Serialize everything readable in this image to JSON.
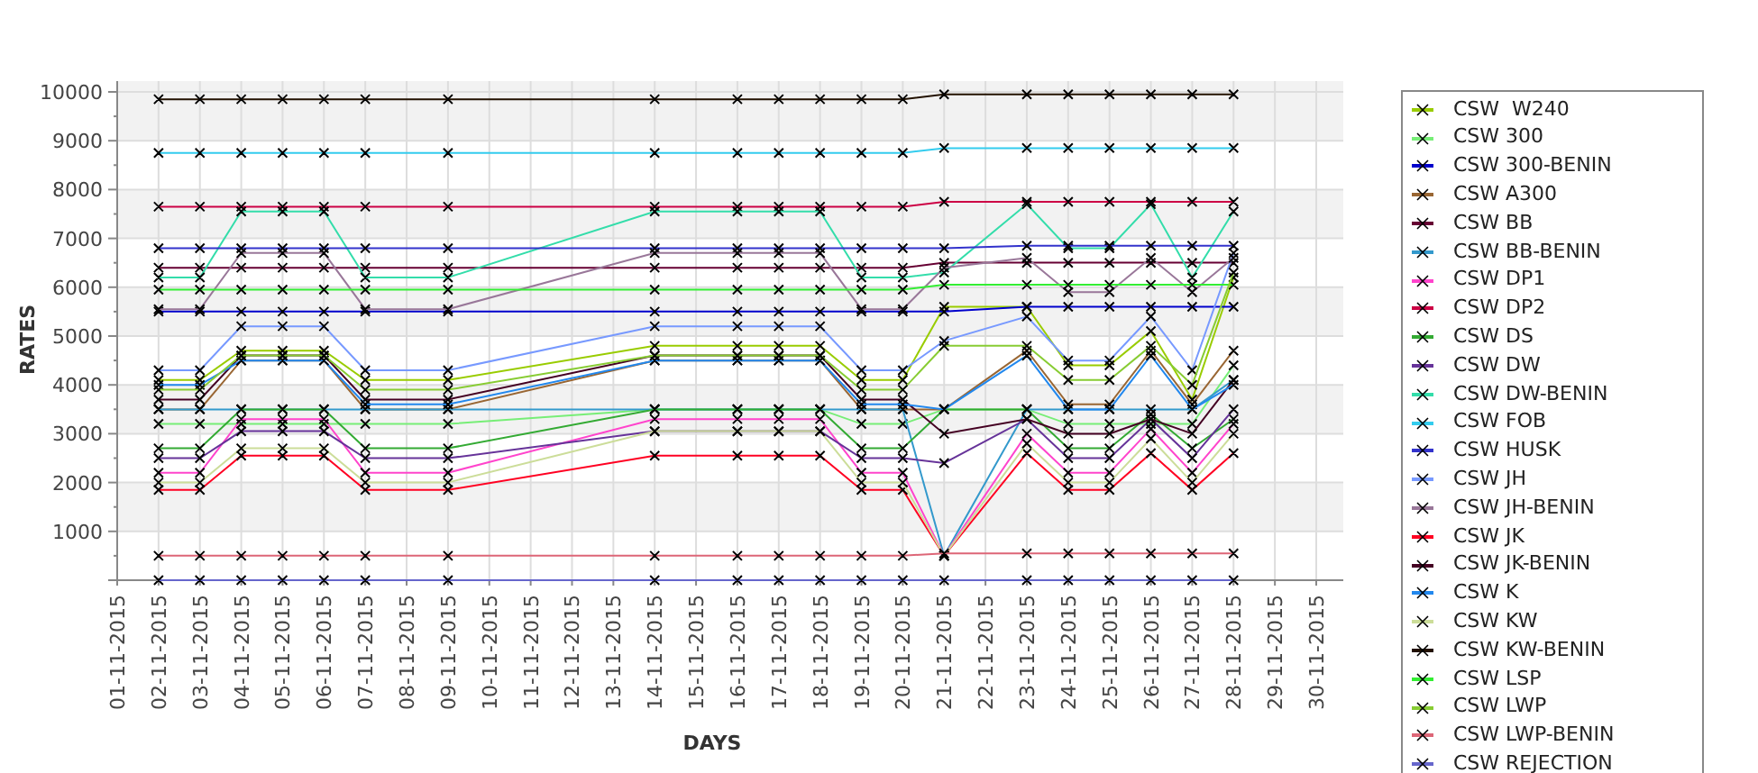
{
  "chart_data": {
    "type": "line",
    "xlabel": "DAYS",
    "ylabel": "RATES",
    "grid": true,
    "categories": [
      "01-11-2015",
      "02-11-2015",
      "03-11-2015",
      "04-11-2015",
      "05-11-2015",
      "06-11-2015",
      "07-11-2015",
      "08-11-2015",
      "09-11-2015",
      "10-11-2015",
      "11-11-2015",
      "12-11-2015",
      "13-11-2015",
      "14-11-2015",
      "15-11-2015",
      "16-11-2015",
      "17-11-2015",
      "18-11-2015",
      "19-11-2015",
      "20-11-2015",
      "21-11-2015",
      "22-11-2015",
      "23-11-2015",
      "24-11-2015",
      "25-11-2015",
      "26-11-2015",
      "27-11-2015",
      "28-11-2015",
      "29-11-2015",
      "30-11-2015"
    ],
    "ylim": [
      0,
      10000
    ],
    "yticks": [
      1000,
      2000,
      3000,
      4000,
      5000,
      6000,
      7000,
      8000,
      9000,
      10000
    ],
    "series": [
      {
        "name": "CSW  W240",
        "color": "#99cc00",
        "marker": "x",
        "values": [
          null,
          4100,
          4100,
          4700,
          4700,
          4700,
          4100,
          null,
          4100,
          null,
          null,
          null,
          null,
          4800,
          null,
          4800,
          4800,
          4800,
          4100,
          4100,
          5600,
          null,
          5600,
          4400,
          4400,
          5100,
          3700,
          6200,
          null,
          null
        ]
      },
      {
        "name": "CSW 300",
        "color": "#77ee77",
        "marker": "x",
        "values": [
          null,
          3200,
          3200,
          3200,
          3200,
          3200,
          3200,
          null,
          3200,
          null,
          null,
          null,
          null,
          3500,
          null,
          3500,
          3500,
          3500,
          3200,
          3200,
          3500,
          null,
          3500,
          3200,
          3200,
          3200,
          3200,
          4400,
          null,
          null
        ]
      },
      {
        "name": "CSW 300-BENIN",
        "color": "#0000cc",
        "marker": "x",
        "values": [
          null,
          5500,
          5500,
          5500,
          5500,
          5500,
          5500,
          null,
          5500,
          null,
          null,
          null,
          null,
          5500,
          null,
          5500,
          5500,
          5500,
          5500,
          5500,
          5500,
          null,
          5600,
          5600,
          5600,
          5600,
          5600,
          5600,
          null,
          null
        ]
      },
      {
        "name": "CSW A300",
        "color": "#996633",
        "marker": "x",
        "values": [
          null,
          3500,
          3500,
          4500,
          4500,
          4500,
          3500,
          null,
          3500,
          null,
          null,
          null,
          null,
          4500,
          null,
          4500,
          4500,
          4500,
          3500,
          3500,
          3500,
          null,
          4700,
          3600,
          3600,
          4700,
          3600,
          4700,
          null,
          null
        ]
      },
      {
        "name": "CSW BB",
        "color": "#660033",
        "marker": "x",
        "values": [
          null,
          6400,
          6400,
          6400,
          6400,
          6400,
          6400,
          null,
          6400,
          null,
          null,
          null,
          null,
          6400,
          null,
          6400,
          6400,
          6400,
          6400,
          6400,
          6500,
          null,
          6500,
          6500,
          6500,
          6500,
          6500,
          6500,
          null,
          null
        ]
      },
      {
        "name": "CSW BB-BENIN",
        "color": "#3399cc",
        "marker": "x",
        "values": [
          null,
          3500,
          3500,
          3500,
          3500,
          3500,
          3500,
          null,
          3500,
          null,
          null,
          null,
          null,
          3500,
          null,
          3500,
          3500,
          3500,
          3500,
          3500,
          500,
          null,
          3500,
          3500,
          3500,
          3500,
          3500,
          4100,
          null,
          null
        ]
      },
      {
        "name": "CSW DP1",
        "color": "#ff44cc",
        "marker": "x",
        "values": [
          null,
          2200,
          2200,
          3300,
          3300,
          3300,
          2200,
          null,
          2200,
          null,
          null,
          null,
          null,
          3300,
          null,
          3300,
          3300,
          3300,
          2200,
          2200,
          500,
          null,
          3000,
          2200,
          2200,
          3100,
          2200,
          3200,
          null,
          null
        ]
      },
      {
        "name": "CSW DP2",
        "color": "#cc0044",
        "marker": "x",
        "values": [
          null,
          7650,
          7650,
          7650,
          7650,
          7650,
          7650,
          null,
          7650,
          null,
          null,
          null,
          null,
          7650,
          null,
          7650,
          7650,
          7650,
          7650,
          7650,
          7750,
          null,
          7750,
          7750,
          7750,
          7750,
          7750,
          7750,
          null,
          null
        ]
      },
      {
        "name": "CSW DS",
        "color": "#33aa33",
        "marker": "x",
        "values": [
          null,
          2700,
          2700,
          3500,
          3500,
          3500,
          2700,
          null,
          2700,
          null,
          null,
          null,
          null,
          3500,
          null,
          3500,
          3500,
          3500,
          2700,
          2700,
          3500,
          null,
          3500,
          2700,
          2700,
          3400,
          2700,
          3300,
          null,
          null
        ]
      },
      {
        "name": "CSW DW",
        "color": "#663399",
        "marker": "x",
        "values": [
          null,
          2500,
          2500,
          3050,
          3050,
          3050,
          2500,
          null,
          2500,
          null,
          null,
          null,
          null,
          3050,
          null,
          3050,
          3050,
          3050,
          2500,
          2500,
          2400,
          null,
          3300,
          2500,
          2500,
          3300,
          2500,
          3500,
          null,
          null
        ]
      },
      {
        "name": "CSW DW-BENIN",
        "color": "#33ddaa",
        "marker": "x",
        "values": [
          null,
          6200,
          6200,
          7550,
          7550,
          7550,
          6200,
          null,
          6200,
          null,
          null,
          null,
          null,
          7550,
          null,
          7550,
          7550,
          7550,
          6200,
          6200,
          6300,
          null,
          7700,
          6800,
          6800,
          7700,
          6200,
          7550,
          null,
          null
        ]
      },
      {
        "name": "CSW FOB",
        "color": "#33ccee",
        "marker": "x",
        "values": [
          null,
          8750,
          8750,
          8750,
          8750,
          8750,
          8750,
          null,
          8750,
          null,
          null,
          null,
          null,
          8750,
          null,
          8750,
          8750,
          8750,
          8750,
          8750,
          8850,
          null,
          8850,
          8850,
          8850,
          8850,
          8850,
          8850,
          null,
          null
        ]
      },
      {
        "name": "CSW HUSK",
        "color": "#3333cc",
        "marker": "x",
        "values": [
          null,
          6800,
          6800,
          6800,
          6800,
          6800,
          6800,
          null,
          6800,
          null,
          null,
          null,
          null,
          6800,
          null,
          6800,
          6800,
          6800,
          6800,
          6800,
          6800,
          null,
          6850,
          6850,
          6850,
          6850,
          6850,
          6850,
          null,
          null
        ]
      },
      {
        "name": "CSW JH",
        "color": "#7799ff",
        "marker": "x",
        "values": [
          null,
          4300,
          4300,
          5200,
          5200,
          5200,
          4300,
          null,
          4300,
          null,
          null,
          null,
          null,
          5200,
          null,
          5200,
          5200,
          5200,
          4300,
          4300,
          4900,
          null,
          5400,
          4500,
          4500,
          5400,
          4300,
          6700,
          null,
          null
        ]
      },
      {
        "name": "CSW JH-BENIN",
        "color": "#997799",
        "marker": "x",
        "values": [
          null,
          5550,
          5550,
          6700,
          6700,
          6700,
          5550,
          null,
          5550,
          null,
          null,
          null,
          null,
          6700,
          null,
          6700,
          6700,
          6700,
          5550,
          5550,
          6400,
          null,
          6600,
          5900,
          5900,
          6600,
          5900,
          6600,
          null,
          null
        ]
      },
      {
        "name": "CSW JK",
        "color": "#ff0022",
        "marker": "x",
        "values": [
          null,
          1850,
          1850,
          2550,
          2550,
          2550,
          1850,
          null,
          1850,
          null,
          null,
          null,
          null,
          2550,
          null,
          2550,
          2550,
          2550,
          1850,
          1850,
          500,
          null,
          2600,
          1850,
          1850,
          2600,
          1850,
          2600,
          null,
          null
        ]
      },
      {
        "name": "CSW JK-BENIN",
        "color": "#440022",
        "marker": "x",
        "values": [
          null,
          3700,
          3700,
          4600,
          4600,
          4600,
          3700,
          null,
          3700,
          null,
          null,
          null,
          null,
          4600,
          null,
          4600,
          4600,
          4600,
          3700,
          3700,
          3000,
          null,
          3300,
          3000,
          3000,
          3300,
          3000,
          4100,
          null,
          null
        ]
      },
      {
        "name": "CSW K",
        "color": "#2288ee",
        "marker": "x",
        "values": [
          null,
          4000,
          4000,
          4500,
          4500,
          4500,
          3600,
          null,
          3600,
          null,
          null,
          null,
          null,
          4500,
          null,
          4500,
          4500,
          4500,
          3600,
          3600,
          3500,
          null,
          4600,
          3500,
          3500,
          4600,
          3500,
          4000,
          null,
          null
        ]
      },
      {
        "name": "CSW KW",
        "color": "#ccdd99",
        "marker": "x",
        "values": [
          null,
          2000,
          2000,
          2700,
          2700,
          2700,
          2000,
          null,
          2000,
          null,
          null,
          null,
          null,
          3050,
          null,
          3050,
          3050,
          3050,
          2000,
          2000,
          500,
          null,
          2800,
          2000,
          2000,
          2900,
          2000,
          3000,
          null,
          null
        ]
      },
      {
        "name": "CSW KW-BENIN",
        "color": "#221100",
        "marker": "x",
        "values": [
          null,
          9850,
          9850,
          9850,
          9850,
          9850,
          9850,
          null,
          9850,
          null,
          null,
          null,
          null,
          9850,
          null,
          9850,
          9850,
          9850,
          9850,
          9850,
          9950,
          null,
          9950,
          9950,
          9950,
          9950,
          9950,
          9950,
          null,
          null
        ]
      },
      {
        "name": "CSW LSP",
        "color": "#33ee33",
        "marker": "x",
        "values": [
          null,
          5950,
          5950,
          5950,
          5950,
          5950,
          5950,
          null,
          5950,
          null,
          null,
          null,
          null,
          5950,
          null,
          5950,
          5950,
          5950,
          5950,
          5950,
          6050,
          null,
          6050,
          6050,
          6050,
          6050,
          6050,
          6050,
          null,
          null
        ]
      },
      {
        "name": "CSW LWP",
        "color": "#88cc33",
        "marker": "x",
        "values": [
          null,
          3900,
          3900,
          4600,
          4600,
          4600,
          3900,
          null,
          3900,
          null,
          null,
          null,
          null,
          4600,
          null,
          4600,
          4600,
          4600,
          3900,
          3900,
          4800,
          null,
          4800,
          4100,
          4100,
          4800,
          4000,
          6300,
          null,
          null
        ]
      },
      {
        "name": "CSW LWP-BENIN",
        "color": "#dd6677",
        "marker": "x",
        "values": [
          null,
          500,
          500,
          500,
          500,
          500,
          500,
          null,
          500,
          null,
          null,
          null,
          null,
          500,
          null,
          500,
          500,
          500,
          500,
          500,
          550,
          null,
          550,
          550,
          550,
          550,
          550,
          550,
          null,
          null
        ]
      },
      {
        "name": "CSW REJECTION",
        "color": "#6666cc",
        "marker": "x",
        "values": [
          null,
          0,
          0,
          0,
          0,
          0,
          0,
          null,
          0,
          null,
          null,
          null,
          null,
          0,
          null,
          0,
          0,
          0,
          0,
          0,
          0,
          null,
          0,
          0,
          0,
          0,
          0,
          0,
          null,
          null
        ]
      }
    ]
  }
}
